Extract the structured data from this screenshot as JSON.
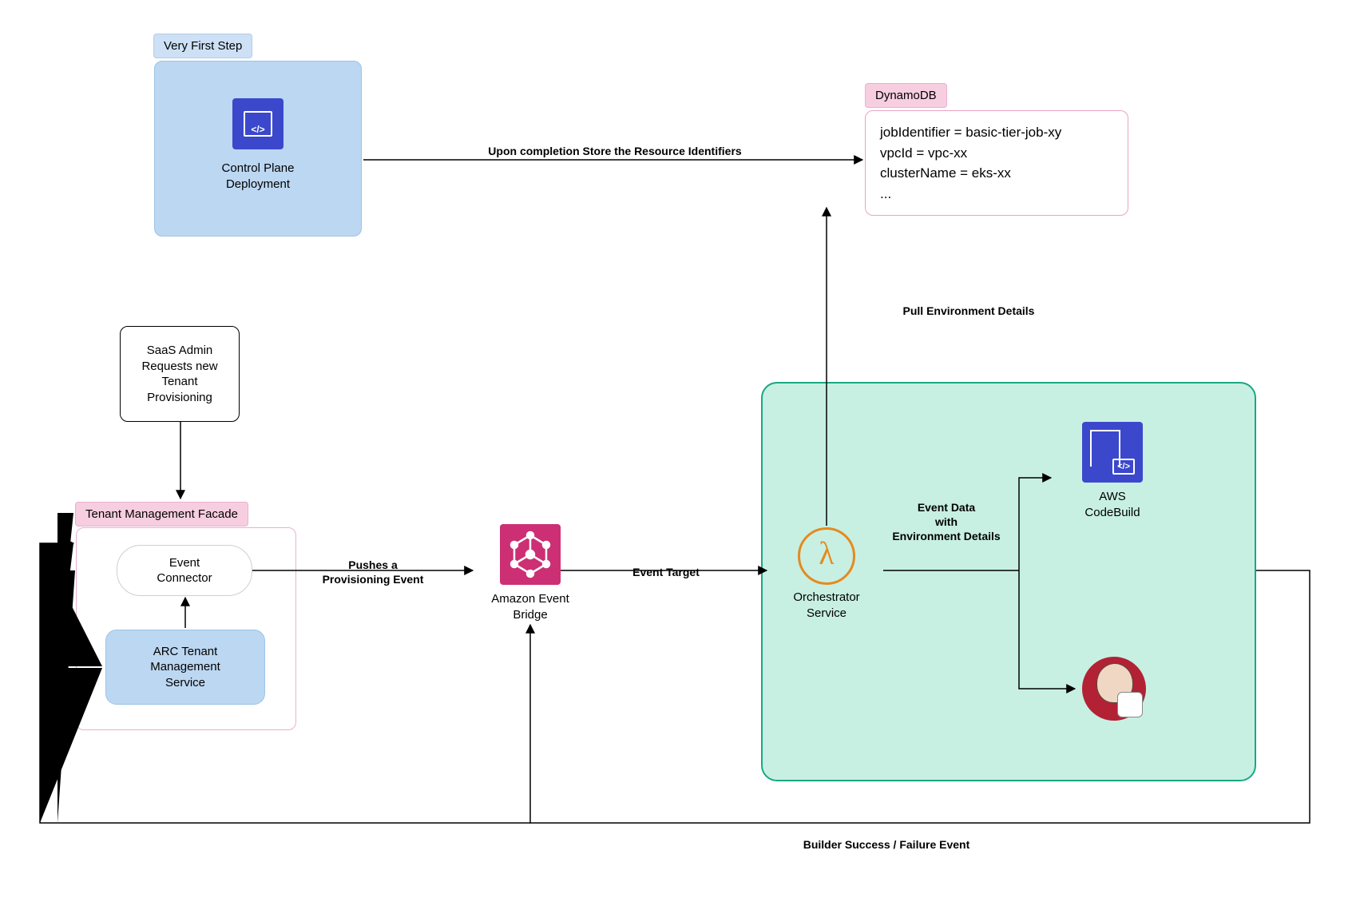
{
  "tags": {
    "firstStep": "Very First Step",
    "dynamo": "DynamoDB",
    "facade": "Tenant Management Facade"
  },
  "nodes": {
    "controlPlane": "Control Plane\nDeployment",
    "saasAdmin": "SaaS Admin\nRequests new\nTenant\nProvisioning",
    "eventConnector": "Event\nConnector",
    "arcTenant": "ARC Tenant\nManagement\nService",
    "eventBridge": "Amazon Event\nBridge",
    "orchestrator": "Orchestrator\nService",
    "codeBuild": "AWS\nCodeBuild"
  },
  "dynamo": {
    "line1": "jobIdentifier = basic-tier-job-xy",
    "line2": "vpcId = vpc-xx",
    "line3": "clusterName = eks-xx",
    "line4": "..."
  },
  "edgeLabels": {
    "storeResource": "Upon completion Store the Resource Identifiers",
    "pushesEvent": "Pushes a\nProvisioning  Event",
    "eventTarget": "Event Target",
    "pullEnv": "Pull Environment Details",
    "eventData": "Event Data\nwith\nEnvironment Details",
    "builderResult": "Builder Success / Failure Event"
  }
}
